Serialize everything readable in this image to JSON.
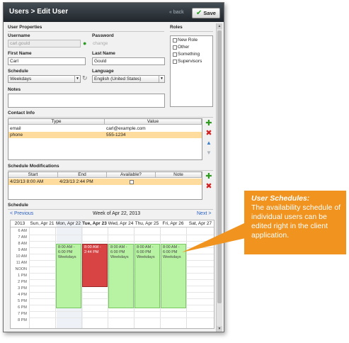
{
  "header": {
    "title": "Users > Edit User",
    "back_label": "« back",
    "save_label": "Save"
  },
  "user_properties": {
    "section_title": "User Properties",
    "username_label": "Username",
    "username_value": "carl.gould",
    "password_label": "Password",
    "password_link": "change",
    "first_name_label": "First Name",
    "first_name_value": "Carl",
    "last_name_label": "Last Name",
    "last_name_value": "Gould",
    "schedule_label": "Schedule",
    "schedule_value": "Weekdays",
    "language_label": "Language",
    "language_value": "English (United States)",
    "notes_label": "Notes",
    "notes_value": ""
  },
  "roles": {
    "section_title": "Roles",
    "items": [
      "New Role",
      "Other",
      "Something",
      "Supervisors"
    ]
  },
  "contact_info": {
    "section_title": "Contact Info",
    "columns": [
      "Type",
      "Value"
    ],
    "rows": [
      {
        "type": "email",
        "value": "carl@example.com"
      },
      {
        "type": "phone",
        "value": "555-1234"
      }
    ]
  },
  "schedule_mods": {
    "section_title": "Schedule Modifications",
    "columns": [
      "Start",
      "End",
      "Available?",
      "Note"
    ],
    "rows": [
      {
        "start": "4/23/13 8:00 AM",
        "end": "4/23/13 2:44 PM",
        "available": false,
        "note": ""
      }
    ]
  },
  "schedule": {
    "section_title": "Schedule",
    "prev_label": "< Previous",
    "week_label": "Week of Apr 22, 2013",
    "next_label": "Next >",
    "year": "2013",
    "days": [
      "Sun, Apr 21",
      "Mon, Apr 22",
      "Tue, Apr 23",
      "Wed, Apr 24",
      "Thu, Apr 25",
      "Fri, Apr 26",
      "Sat, Apr 27"
    ],
    "hours": [
      "6 AM",
      "7 AM",
      "8 AM",
      "9 AM",
      "10 AM",
      "11 AM",
      "NOON",
      "1 PM",
      "2 PM",
      "3 PM",
      "4 PM",
      "5 PM",
      "6 PM",
      "7 PM",
      "8 PM"
    ],
    "events": [
      {
        "time": "8:00 AM - 6:00 PM",
        "label": "Weekdays"
      },
      {
        "time": "8:00 AM - 2:44 PM",
        "label": ""
      },
      {
        "time": "8:00 AM - 6:00 PM",
        "label": "Weekdays"
      },
      {
        "time": "8:00 AM - 6:00 PM",
        "label": "Weekdays"
      },
      {
        "time": "8:00 AM - 6:00 PM",
        "label": "Weekdays"
      }
    ]
  },
  "callout": {
    "title": "User Schedules:",
    "body": "The availability schedule of individual users can be edited right in the client application."
  },
  "colors": {
    "accent": "#f0941f",
    "event": "#b8f2a3",
    "selected_event": "#d84344",
    "row_highlight": "#fddc9d"
  }
}
